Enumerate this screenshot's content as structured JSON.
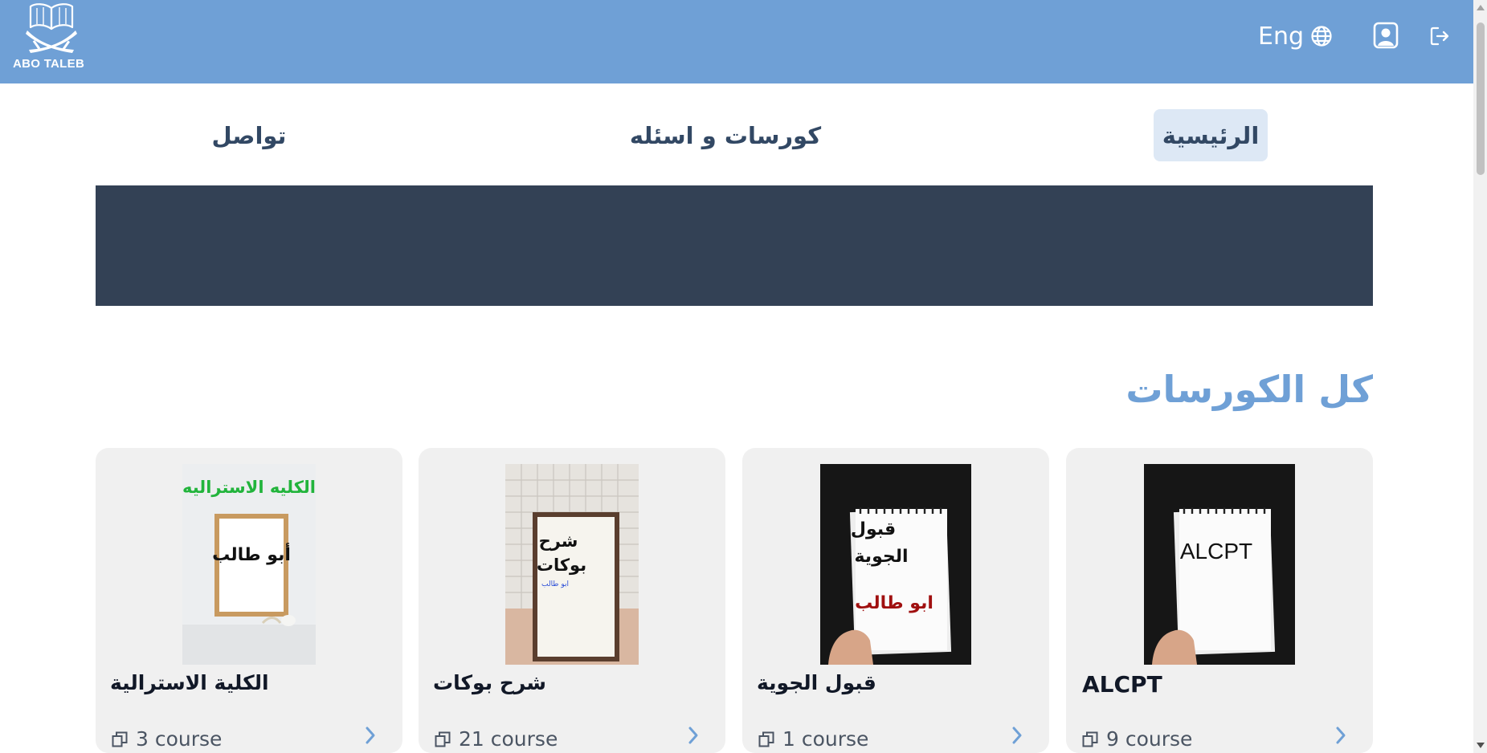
{
  "header": {
    "logo_text": "ABO TALEB",
    "lang_label": "Eng",
    "icons": {
      "language": "globe-icon",
      "profile": "user-square-icon",
      "logout": "logout-icon",
      "logo": "book-swords-logo"
    },
    "colors": {
      "header_bg": "#6fa0d6",
      "nav_text": "#324864",
      "active_nav_bg": "#dde8f5",
      "banner": "#334155",
      "title_accent": "#6fa0d6"
    }
  },
  "nav": {
    "home": "الرئيسية",
    "courses": "كورسات و اسئله",
    "contact": "تواصل"
  },
  "section": {
    "title": "كل الكورسات"
  },
  "courses": [
    {
      "title": "الكلية الاسترالية",
      "count": "3 course",
      "image_caption": "الكليه الاستراليه",
      "image_text": "أبو طالب"
    },
    {
      "title": "شرح بوكات",
      "count": "21 course",
      "image_text_1": "شرح",
      "image_text_2": "بوكات",
      "image_text_3": "ابو طالب"
    },
    {
      "title": "قبول الجوية",
      "count": "1 course",
      "image_text_1": "قبول",
      "image_text_2": "الجوية",
      "image_text_3": "ابو طالب"
    },
    {
      "title": "ALCPT",
      "count": "9 course",
      "image_text": "ALCPT"
    }
  ]
}
